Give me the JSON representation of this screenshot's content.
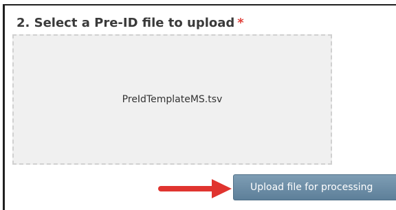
{
  "section": {
    "heading": "2. Select a Pre-ID file to upload",
    "required_marker": "*"
  },
  "dropzone": {
    "file_name": "PreIdTemplateMS.tsv"
  },
  "actions": {
    "upload_label": "Upload file for processing"
  },
  "colors": {
    "required": "#e0403a",
    "button": "#6a8ba3",
    "arrow": "#e0342f"
  },
  "icons": {
    "arrow": "red-arrow-icon"
  }
}
